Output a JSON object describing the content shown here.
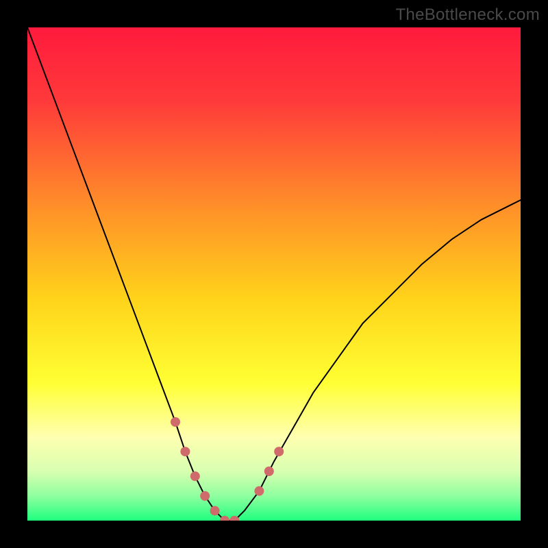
{
  "watermark": "TheBottleneck.com",
  "chart_data": {
    "type": "line",
    "title": "",
    "xlabel": "",
    "ylabel": "",
    "xlim": [
      0,
      100
    ],
    "ylim": [
      0,
      100
    ],
    "background_gradient": {
      "stops": [
        {
          "offset": 0.0,
          "color": "#ff1a3d"
        },
        {
          "offset": 0.15,
          "color": "#ff3a3a"
        },
        {
          "offset": 0.35,
          "color": "#ff8a2a"
        },
        {
          "offset": 0.55,
          "color": "#ffd31a"
        },
        {
          "offset": 0.72,
          "color": "#ffff33"
        },
        {
          "offset": 0.83,
          "color": "#ffffb0"
        },
        {
          "offset": 0.9,
          "color": "#d8ffb0"
        },
        {
          "offset": 0.95,
          "color": "#8fff9f"
        },
        {
          "offset": 1.0,
          "color": "#1fff7f"
        }
      ]
    },
    "series": [
      {
        "name": "bottleneck-curve",
        "stroke": "#000000",
        "stroke_width": 2,
        "x": [
          0,
          3,
          6,
          9,
          12,
          15,
          18,
          21,
          24,
          27,
          30,
          32,
          34,
          36,
          38,
          40,
          42,
          44,
          47,
          50,
          54,
          58,
          63,
          68,
          74,
          80,
          86,
          92,
          98,
          100
        ],
        "y": [
          100,
          92,
          84,
          76,
          68,
          60,
          52,
          44,
          36,
          28,
          20,
          14,
          9,
          5,
          2,
          0,
          0,
          2,
          6,
          12,
          19,
          26,
          33,
          40,
          46,
          52,
          57,
          61,
          64,
          65
        ]
      }
    ],
    "markers": [
      {
        "name": "left-valley-markers",
        "color": "#cf6b6b",
        "radius": 7,
        "points": [
          {
            "x": 30,
            "y": 20
          },
          {
            "x": 32,
            "y": 14
          },
          {
            "x": 34,
            "y": 9
          },
          {
            "x": 36,
            "y": 5
          },
          {
            "x": 38,
            "y": 2
          },
          {
            "x": 40,
            "y": 0
          },
          {
            "x": 42,
            "y": 0
          }
        ]
      },
      {
        "name": "right-valley-markers",
        "color": "#cf6b6b",
        "radius": 7,
        "points": [
          {
            "x": 47,
            "y": 6
          },
          {
            "x": 49,
            "y": 10
          },
          {
            "x": 51,
            "y": 14
          }
        ]
      }
    ]
  }
}
